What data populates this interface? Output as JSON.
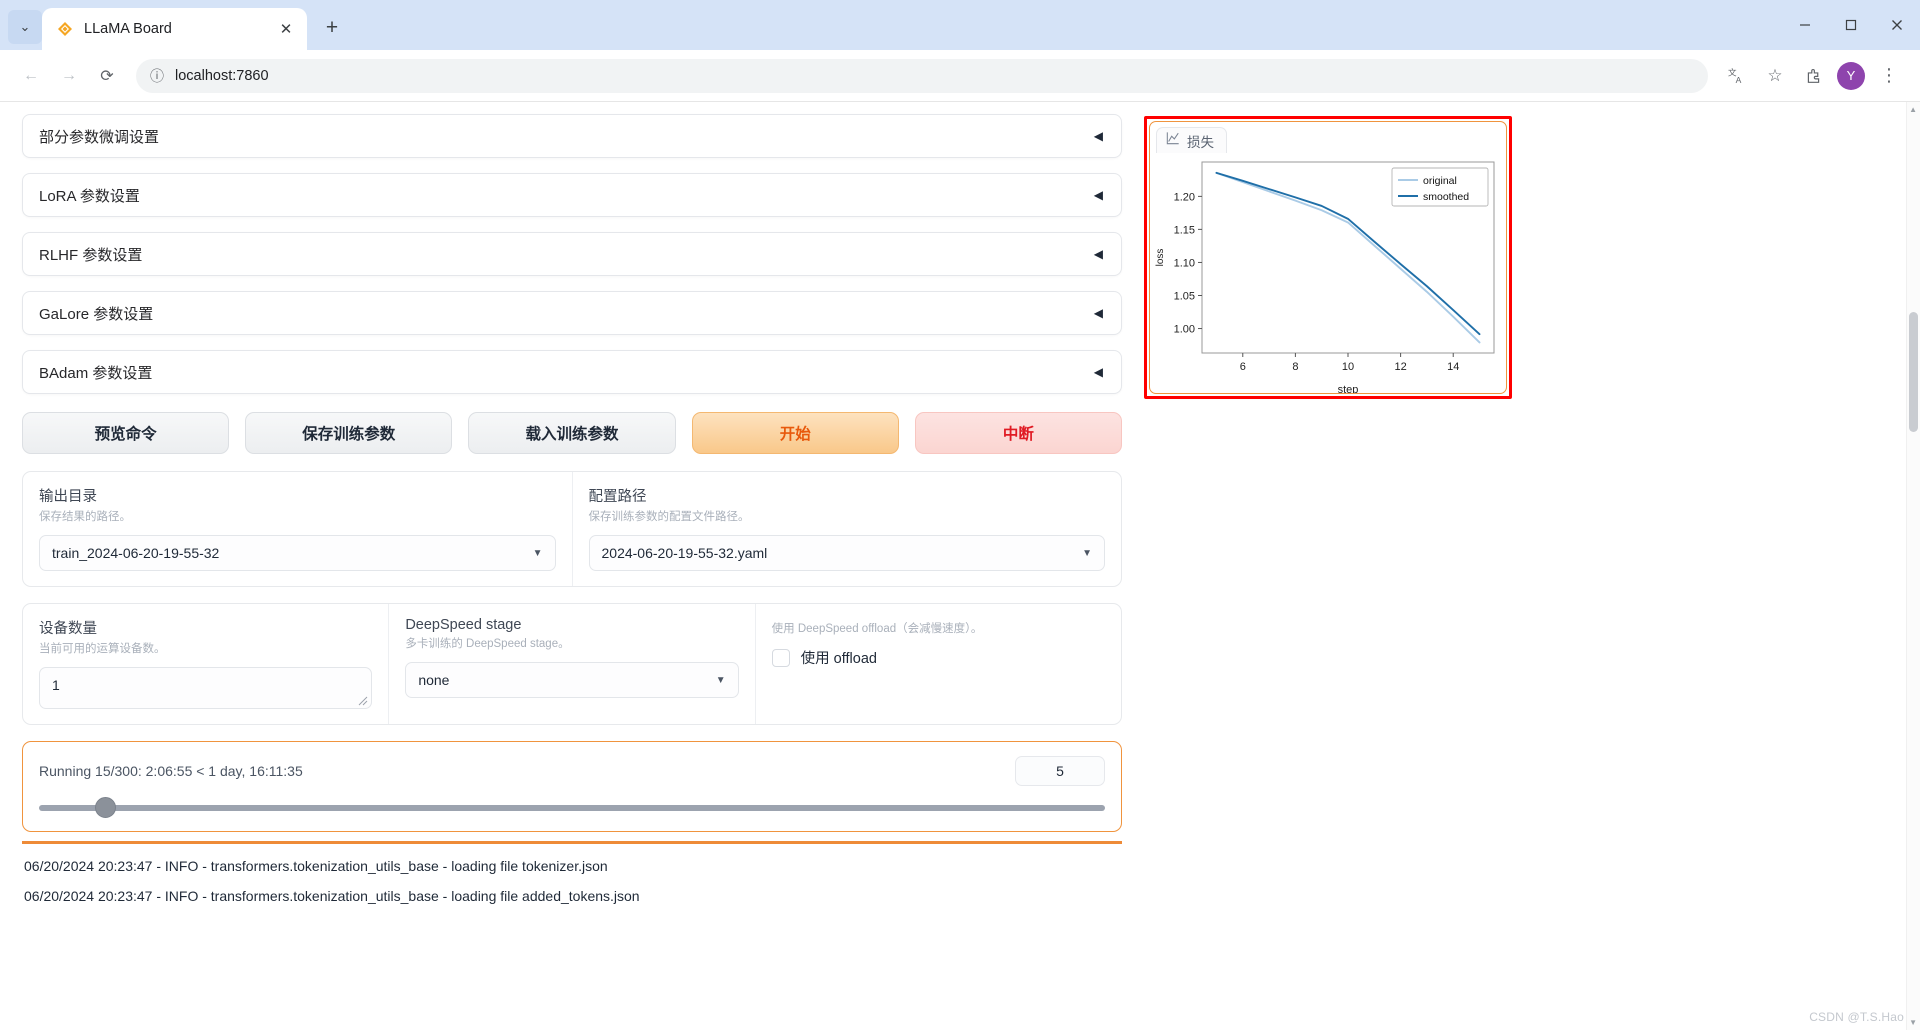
{
  "browser": {
    "tab_title": "LLaMA Board",
    "favicon": "llama-board-logo",
    "tab_close": "✕",
    "new_tab": "+",
    "chevron": "⌄",
    "back": "←",
    "forward": "→",
    "reload": "⟳",
    "site_info": "ⓘ",
    "url": "localhost:7860",
    "translate": "translate-icon",
    "bookmark": "☆",
    "extensions": "extensions-icon",
    "profile_initial": "Y",
    "menu": "⋮",
    "minimize": "—",
    "maximize": "▢",
    "close": "✕"
  },
  "accordions": [
    {
      "label": "部分参数微调设置",
      "arrow": "◀"
    },
    {
      "label": "LoRA 参数设置",
      "arrow": "◀"
    },
    {
      "label": "RLHF 参数设置",
      "arrow": "◀"
    },
    {
      "label": "GaLore 参数设置",
      "arrow": "◀"
    },
    {
      "label": "BAdam 参数设置",
      "arrow": "◀"
    }
  ],
  "buttons": {
    "preview": "预览命令",
    "save": "保存训练参数",
    "load": "载入训练参数",
    "start": "开始",
    "abort": "中断",
    "start_color": "#e8590c",
    "abort_color": "#e01b24"
  },
  "paths": {
    "output_dir": {
      "label": "输出目录",
      "info": "保存结果的路径。",
      "value": "train_2024-06-20-19-55-32",
      "caret": "▼"
    },
    "config_path": {
      "label": "配置路径",
      "info": "保存训练参数的配置文件路径。",
      "value": "2024-06-20-19-55-32.yaml",
      "caret": "▼"
    }
  },
  "compute": {
    "device_count": {
      "label": "设备数量",
      "info": "当前可用的运算设备数。",
      "value": "1"
    },
    "deepspeed_stage": {
      "label": "DeepSpeed stage",
      "info": "多卡训练的 DeepSpeed stage。",
      "value": "none",
      "caret": "▼"
    },
    "offload": {
      "info": "使用 DeepSpeed offload（会减慢速度）。",
      "checkbox_label": "使用 offload",
      "checked": false
    }
  },
  "progress": {
    "status": "Running 15/300: 2:06:55 < 1 day, 16:11:35",
    "value": "5",
    "slider_percent": 5.3,
    "border_color": "#f0943e"
  },
  "logs": [
    "06/20/2024 20:23:47 - INFO - transformers.tokenization_utils_base - loading file tokenizer.json",
    "06/20/2024 20:23:47 - INFO - transformers.tokenization_utils_base - loading file added_tokens.json"
  ],
  "chart_panel": {
    "tab_label": "损失",
    "tab_icon": "line-chart-icon",
    "highlight_color": "#ff0000"
  },
  "watermark": "CSDN @T.S.Hao",
  "chart_data": {
    "type": "line",
    "title": "",
    "xlabel": "step",
    "ylabel": "loss",
    "xlim": [
      4.45,
      15.55
    ],
    "ylim": [
      0.963,
      1.252
    ],
    "xticks": [
      6,
      8,
      10,
      12,
      14
    ],
    "yticks": [
      1.0,
      1.05,
      1.1,
      1.15,
      1.2
    ],
    "ytick_labels": [
      "1.00",
      "1.05",
      "1.10",
      "1.15",
      "1.20"
    ],
    "xtick_labels": [
      "6",
      "8",
      "10",
      "12",
      "14"
    ],
    "grid": false,
    "legend_position": "upper right",
    "x": [
      5,
      6,
      7,
      8,
      9,
      10,
      11,
      12,
      13,
      14,
      15
    ],
    "series": [
      {
        "name": "original",
        "color": "#aacbe6",
        "values": [
          1.2355,
          1.2215,
          1.2075,
          1.1935,
          1.179,
          1.1605,
          1.1255,
          1.0905,
          1.0555,
          1.018,
          0.979
        ]
      },
      {
        "name": "smoothed",
        "color": "#1f6fa8",
        "values": [
          1.2355,
          1.2235,
          1.211,
          1.1985,
          1.1855,
          1.166,
          1.1315,
          1.0975,
          1.064,
          1.028,
          0.9915
        ]
      }
    ]
  }
}
